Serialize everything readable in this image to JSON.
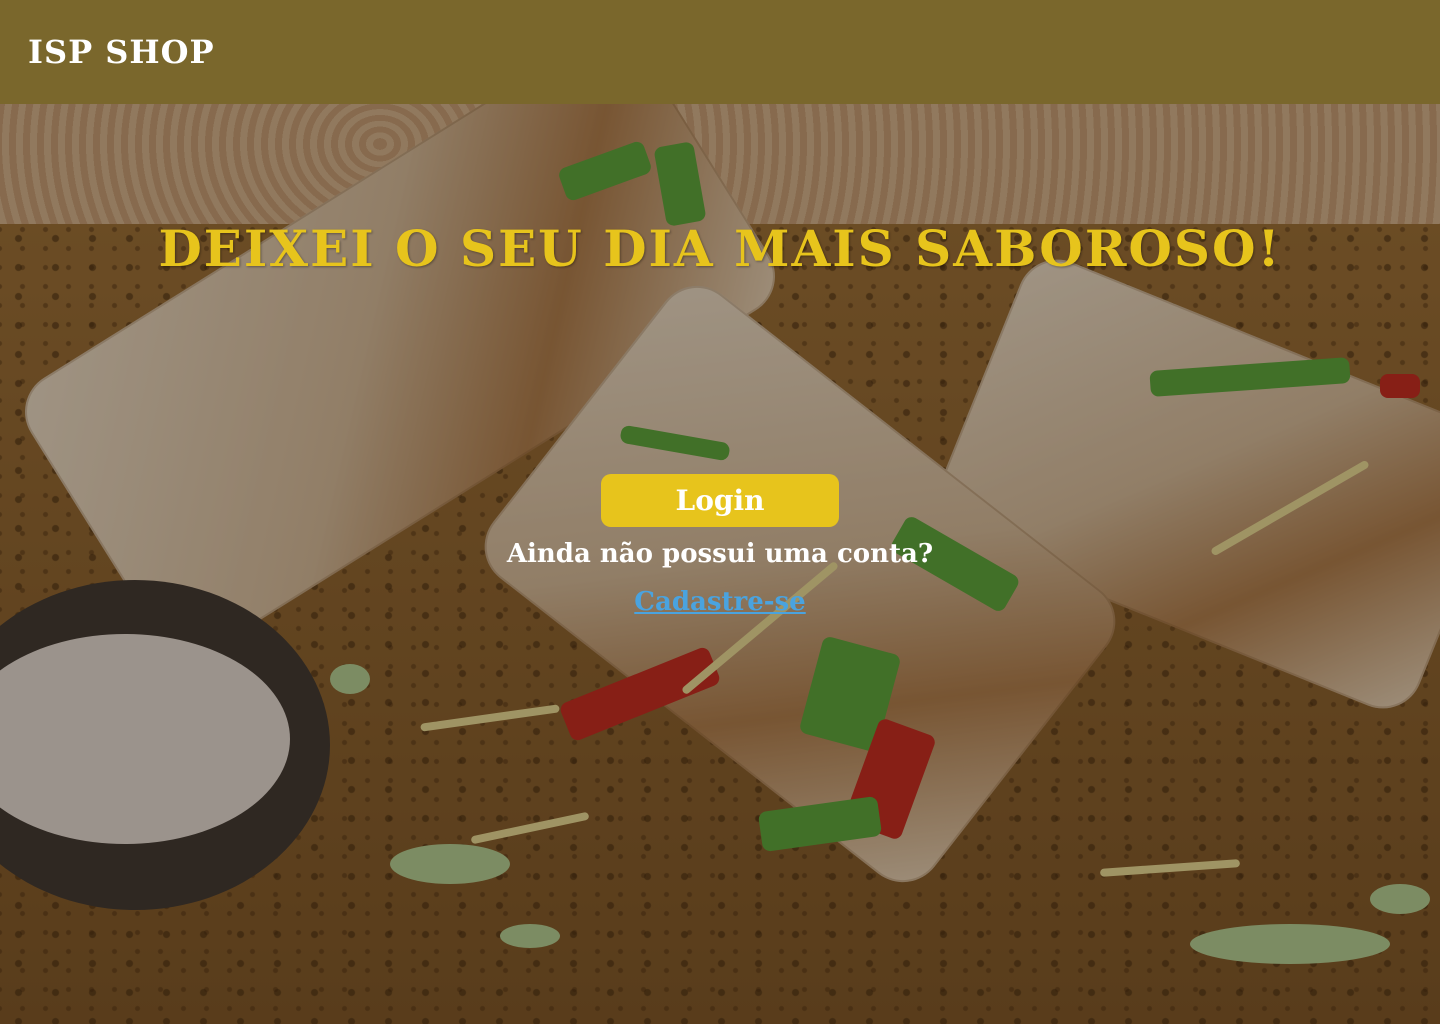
{
  "header": {
    "brand": "ISP SHOP"
  },
  "hero": {
    "headline": "DEIXEI O SEU DIA MAIS SABOROSO!",
    "login_label": "Login",
    "question": "Ainda não possui uma conta?",
    "signup_label": "Cadastre-se"
  },
  "colors": {
    "header_bg": "#7a672c",
    "accent": "#e7c41c",
    "link": "#4aa3df",
    "text": "#ffffff"
  }
}
